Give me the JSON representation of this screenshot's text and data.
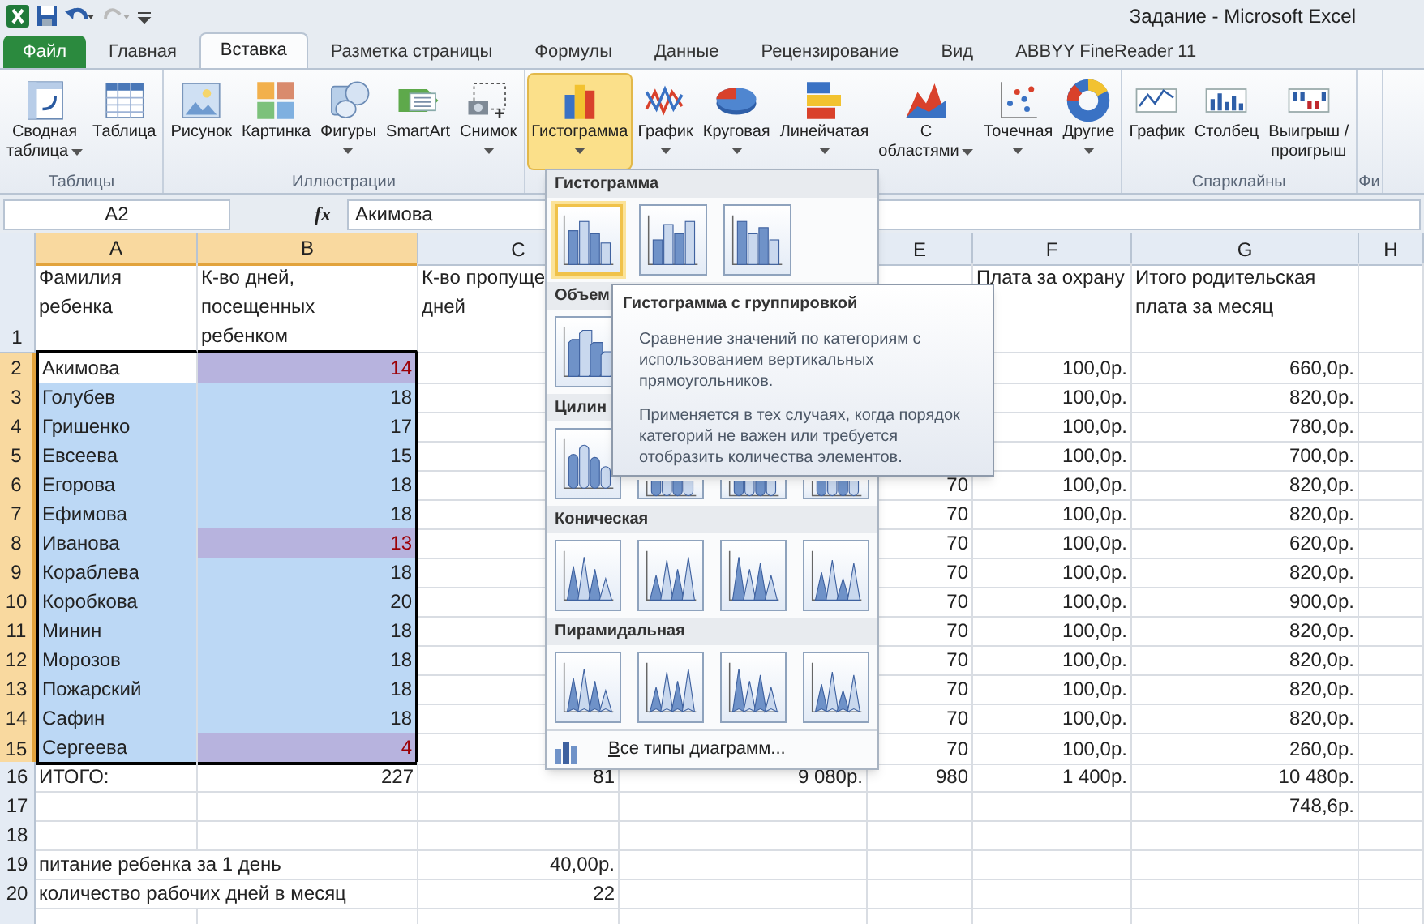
{
  "window": {
    "title": "Задание - Microsoft Excel"
  },
  "tabs": [
    {
      "label": "Файл",
      "kind": "file",
      "selected": false
    },
    {
      "label": "Главная",
      "kind": "tab",
      "selected": false
    },
    {
      "label": "Вставка",
      "kind": "tab",
      "selected": true
    },
    {
      "label": "Разметка страницы",
      "kind": "tab",
      "selected": false
    },
    {
      "label": "Формулы",
      "kind": "tab",
      "selected": false
    },
    {
      "label": "Данные",
      "kind": "tab",
      "selected": false
    },
    {
      "label": "Рецензирование",
      "kind": "tab",
      "selected": false
    },
    {
      "label": "Вид",
      "kind": "tab",
      "selected": false
    },
    {
      "label": "ABBYY FineReader 11",
      "kind": "tab",
      "selected": false
    }
  ],
  "ribbon_groups": [
    {
      "label": "Таблицы",
      "buttons": [
        {
          "lines": [
            "Сводная",
            "таблица"
          ],
          "kind": "pivot",
          "dropdown": true,
          "selected": false
        },
        {
          "lines": [
            "Таблица"
          ],
          "kind": "table",
          "dropdown": false,
          "selected": false
        }
      ]
    },
    {
      "label": "Иллюстрации",
      "buttons": [
        {
          "lines": [
            "Рисунок"
          ],
          "kind": "picture",
          "dropdown": false,
          "selected": false
        },
        {
          "lines": [
            "Картинка"
          ],
          "kind": "clipart",
          "dropdown": false,
          "selected": false
        },
        {
          "lines": [
            "Фигуры"
          ],
          "kind": "shapes",
          "dropdown": true,
          "selected": false
        },
        {
          "lines": [
            "SmartArt"
          ],
          "kind": "smartart",
          "dropdown": false,
          "selected": false
        },
        {
          "lines": [
            "Снимок"
          ],
          "kind": "screenshot",
          "dropdown": true,
          "selected": false
        }
      ]
    },
    {
      "buttons": [
        {
          "lines": [
            "Гистограмма"
          ],
          "kind": "column",
          "dropdown": true,
          "selected": true
        },
        {
          "lines": [
            "График"
          ],
          "kind": "line",
          "dropdown": true,
          "selected": false
        },
        {
          "lines": [
            "Круговая"
          ],
          "kind": "pie",
          "dropdown": true,
          "selected": false
        },
        {
          "lines": [
            "Линейчатая"
          ],
          "kind": "bar",
          "dropdown": true,
          "selected": false
        },
        {
          "lines": [
            "С",
            "областями"
          ],
          "kind": "area",
          "dropdown": true,
          "selected": false
        },
        {
          "lines": [
            "Точечная"
          ],
          "kind": "scatter",
          "dropdown": true,
          "selected": false
        },
        {
          "lines": [
            "Другие"
          ],
          "kind": "other",
          "dropdown": true,
          "selected": false
        }
      ]
    },
    {
      "label": "Спарклайны",
      "buttons": [
        {
          "lines": [
            "График"
          ],
          "kind": "spark_line",
          "dropdown": false,
          "selected": false
        },
        {
          "lines": [
            "Столбец"
          ],
          "kind": "spark_column",
          "dropdown": false,
          "selected": false
        },
        {
          "lines": [
            "Выигрыш /",
            "проигрыш"
          ],
          "kind": "spark_winloss",
          "dropdown": false,
          "selected": false
        }
      ]
    },
    {
      "label": "Фи"
    }
  ],
  "formula_bar": {
    "name_box": "A2",
    "function_label": "fx",
    "value": "Акимова"
  },
  "columns": [
    {
      "label": "A",
      "selected": true
    },
    {
      "label": "B",
      "selected": true
    },
    {
      "label": "C",
      "selected": false
    },
    {
      "label": "E",
      "selected": false
    },
    {
      "label": "F",
      "selected": false
    },
    {
      "label": "G",
      "selected": false
    },
    {
      "label": "H",
      "selected": false
    }
  ],
  "header_row": {
    "number": "1",
    "A": "Фамилия\nребенка",
    "B": "К-во дней,\nпосещенных\nребенком",
    "C": "К-во пропуще\nдней",
    "F": "Плата за охрану",
    "G": "Итого родительская\nплата за месяц"
  },
  "rows": [
    {
      "number": "2",
      "selected": true,
      "active": true,
      "flagged": true,
      "A": "Акимова",
      "B": "14",
      "F": "100,0р.",
      "G": "660,0р."
    },
    {
      "number": "3",
      "selected": true,
      "active": false,
      "flagged": false,
      "A": "Голубев",
      "B": "18",
      "F": "100,0р.",
      "G": "820,0р."
    },
    {
      "number": "4",
      "selected": true,
      "active": false,
      "flagged": false,
      "A": "Гришенко",
      "B": "17",
      "F": "100,0р.",
      "G": "780,0р."
    },
    {
      "number": "5",
      "selected": true,
      "active": false,
      "flagged": false,
      "A": "Евсеева",
      "B": "15",
      "F": "100,0р.",
      "G": "700,0р."
    },
    {
      "number": "6",
      "selected": true,
      "active": false,
      "flagged": false,
      "A": "Егорова",
      "B": "18",
      "E": "70",
      "F": "100,0р.",
      "G": "820,0р."
    },
    {
      "number": "7",
      "selected": true,
      "active": false,
      "flagged": false,
      "A": "Ефимова",
      "B": "18",
      "E": "70",
      "F": "100,0р.",
      "G": "820,0р."
    },
    {
      "number": "8",
      "selected": true,
      "active": false,
      "flagged": true,
      "A": "Иванова",
      "B": "13",
      "E": "70",
      "F": "100,0р.",
      "G": "620,0р."
    },
    {
      "number": "9",
      "selected": true,
      "active": false,
      "flagged": false,
      "A": "Кораблева",
      "B": "18",
      "E": "70",
      "F": "100,0р.",
      "G": "820,0р."
    },
    {
      "number": "10",
      "selected": true,
      "active": false,
      "flagged": false,
      "A": "Коробкова",
      "B": "20",
      "E": "70",
      "F": "100,0р.",
      "G": "900,0р."
    },
    {
      "number": "11",
      "selected": true,
      "active": false,
      "flagged": false,
      "A": "Минин",
      "B": "18",
      "E": "70",
      "F": "100,0р.",
      "G": "820,0р."
    },
    {
      "number": "12",
      "selected": true,
      "active": false,
      "flagged": false,
      "A": "Морозов",
      "B": "18",
      "E": "70",
      "F": "100,0р.",
      "G": "820,0р."
    },
    {
      "number": "13",
      "selected": true,
      "active": false,
      "flagged": false,
      "A": "Пожарский",
      "B": "18",
      "E": "70",
      "F": "100,0р.",
      "G": "820,0р."
    },
    {
      "number": "14",
      "selected": true,
      "active": false,
      "flagged": false,
      "A": "Сафин",
      "B": "18",
      "E": "70",
      "F": "100,0р.",
      "G": "820,0р."
    },
    {
      "number": "15",
      "selected": true,
      "active": false,
      "flagged": true,
      "A": "Сергеева",
      "B": "4",
      "E": "70",
      "F": "100,0р.",
      "G": "260,0р."
    },
    {
      "number": "16",
      "selected": false,
      "active": false,
      "flagged": false,
      "A": "ИТОГО:",
      "B": "227",
      "C": "81",
      "D": "9 080р.",
      "E": "980",
      "F": "1 400р.",
      "G": "10 480р."
    },
    {
      "number": "17",
      "selected": false,
      "active": false,
      "flagged": false,
      "G": "748,6р."
    },
    {
      "number": "18",
      "selected": false,
      "active": false,
      "flagged": false
    },
    {
      "number": "19",
      "selected": false,
      "active": false,
      "flagged": false,
      "A": "питание ребенка за 1 день",
      "C": "40,00р."
    },
    {
      "number": "20",
      "selected": false,
      "active": false,
      "flagged": false,
      "A": "количество рабочих дней в месяц",
      "C": "22"
    }
  ],
  "chart_menu": {
    "sections": [
      {
        "title": "Гистограмма",
        "kind": "column",
        "items": [
          {
            "selected": true
          },
          {
            "selected": false
          },
          {
            "selected": false
          }
        ]
      },
      {
        "title": "Объем",
        "kind": "column3d",
        "items": [
          {
            "selected": false
          }
        ]
      },
      {
        "title": "Цилин",
        "kind": "cylinder",
        "items": [
          {
            "selected": false
          },
          {
            "selected": false
          },
          {
            "selected": false
          },
          {
            "selected": false
          }
        ]
      },
      {
        "title": "Коническая",
        "kind": "cone",
        "items": [
          {
            "selected": false
          },
          {
            "selected": false
          },
          {
            "selected": false
          },
          {
            "selected": false
          }
        ]
      },
      {
        "title": "Пирамидальная",
        "kind": "pyramid",
        "items": [
          {
            "selected": false
          },
          {
            "selected": false
          },
          {
            "selected": false
          },
          {
            "selected": false
          }
        ]
      }
    ],
    "footer": "Все типы диаграмм..."
  },
  "tooltip": {
    "title": "Гистограмма с группировкой",
    "paragraphs": [
      "Сравнение значений по категориям с использованием вертикальных прямоугольников.",
      "Применяется в тех случаях, когда порядок категорий не важен или требуется отобразить количества элементов."
    ]
  }
}
